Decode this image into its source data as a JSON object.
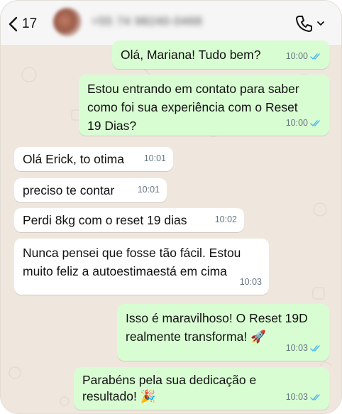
{
  "header": {
    "back_count": "17",
    "contact_name": "+55 74 98240-0468"
  },
  "colors": {
    "outgoing_bubble": "#d9fdd3",
    "incoming_bubble": "#ffffff",
    "read_ticks": "#53bdeb",
    "wallpaper": "#efe7de"
  },
  "messages": [
    {
      "direction": "out",
      "text": "Olá, Mariana! Tudo bem?",
      "time": "10:00",
      "status": "read"
    },
    {
      "direction": "out",
      "text": "Estou entrando em contato para saber\ncomo foi sua experiência com o Reset\n19 Dias?",
      "time": "10:00",
      "status": "read"
    },
    {
      "direction": "in",
      "text": "Olá Erick, to otima",
      "time": "10:01"
    },
    {
      "direction": "in",
      "text": "preciso te contar",
      "time": "10:01"
    },
    {
      "direction": "in",
      "text": "Perdi 8kg com o reset 19 dias",
      "time": "10:02"
    },
    {
      "direction": "in",
      "text": "Nunca pensei que fosse tão fácil. Estou\nmuito feliz a autoestimaestá em cima",
      "time": "10:03"
    },
    {
      "direction": "out",
      "text": "Isso é maravilhoso! O Reset 19D\nrealmente transforma! 🚀",
      "time": "10:03",
      "status": "read"
    },
    {
      "direction": "out",
      "text": "Parabéns pela sua dedicação e\nresultado! 🎉",
      "time": "10:03",
      "status": "read"
    }
  ]
}
